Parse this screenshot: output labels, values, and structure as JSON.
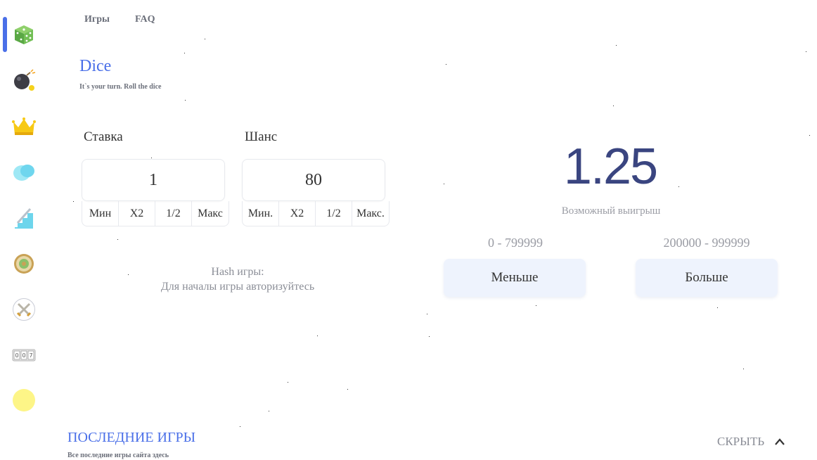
{
  "nav": {
    "games": "Игры",
    "faq": "FAQ"
  },
  "sidebar": {
    "items": [
      {
        "name": "dice-icon",
        "active": true
      },
      {
        "name": "bomb-icon"
      },
      {
        "name": "crown-icon"
      },
      {
        "name": "coin-flip-icon"
      },
      {
        "name": "stairs-icon"
      },
      {
        "name": "wheel-icon"
      },
      {
        "name": "swords-icon"
      },
      {
        "name": "slots-icon"
      },
      {
        "name": "yellow-circle-icon"
      }
    ]
  },
  "game": {
    "title": "Dice",
    "subtitle": "It`s your turn. Roll the dice"
  },
  "bet": {
    "label": "Ставка",
    "value": "1",
    "mods": [
      "Мин",
      "X2",
      "1/2",
      "Макс"
    ]
  },
  "chance": {
    "label": "Шанс",
    "value": "80",
    "mods": [
      "Мин.",
      "X2",
      "1/2",
      "Макс."
    ]
  },
  "hash": {
    "label": "Hash игры:",
    "note": "Для началы игры авторизуйтесь"
  },
  "result": {
    "value": "1.25",
    "label": "Возможный выигрыш"
  },
  "less": {
    "range": "0 - 799999",
    "label": "Меньше"
  },
  "more": {
    "range": "200000 - 999999",
    "label": "Больше"
  },
  "last_games": {
    "title": "ПОСЛЕДНИЕ ИГРЫ",
    "subtitle": "Все последние игры сайта здесь",
    "hide_label": "СКРЫТЬ"
  },
  "colors": {
    "accent": "#4a6fe8",
    "result": "#3a4580",
    "button_bg": "#eef3fd"
  }
}
